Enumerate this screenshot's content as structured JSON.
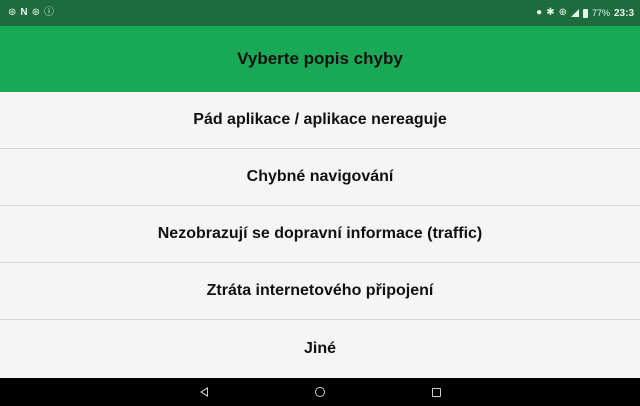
{
  "status_bar": {
    "left_icons": [
      "notification-icon",
      "n-icon",
      "notification-icon",
      "info-icon"
    ],
    "battery": "77%",
    "time": "23:3"
  },
  "header": {
    "title": "Vyberte popis chyby"
  },
  "options": [
    {
      "label": "Pád aplikace / aplikace nereaguje"
    },
    {
      "label": "Chybné navigování"
    },
    {
      "label": "Nezobrazují se dopravní informace (traffic)"
    },
    {
      "label": "Ztráta internetového připojení"
    },
    {
      "label": "Jiné"
    }
  ],
  "colors": {
    "status_bar": "#1e6b3e",
    "header": "#19a956",
    "list_bg": "#f5f5f5",
    "nav_bar": "#000000"
  }
}
